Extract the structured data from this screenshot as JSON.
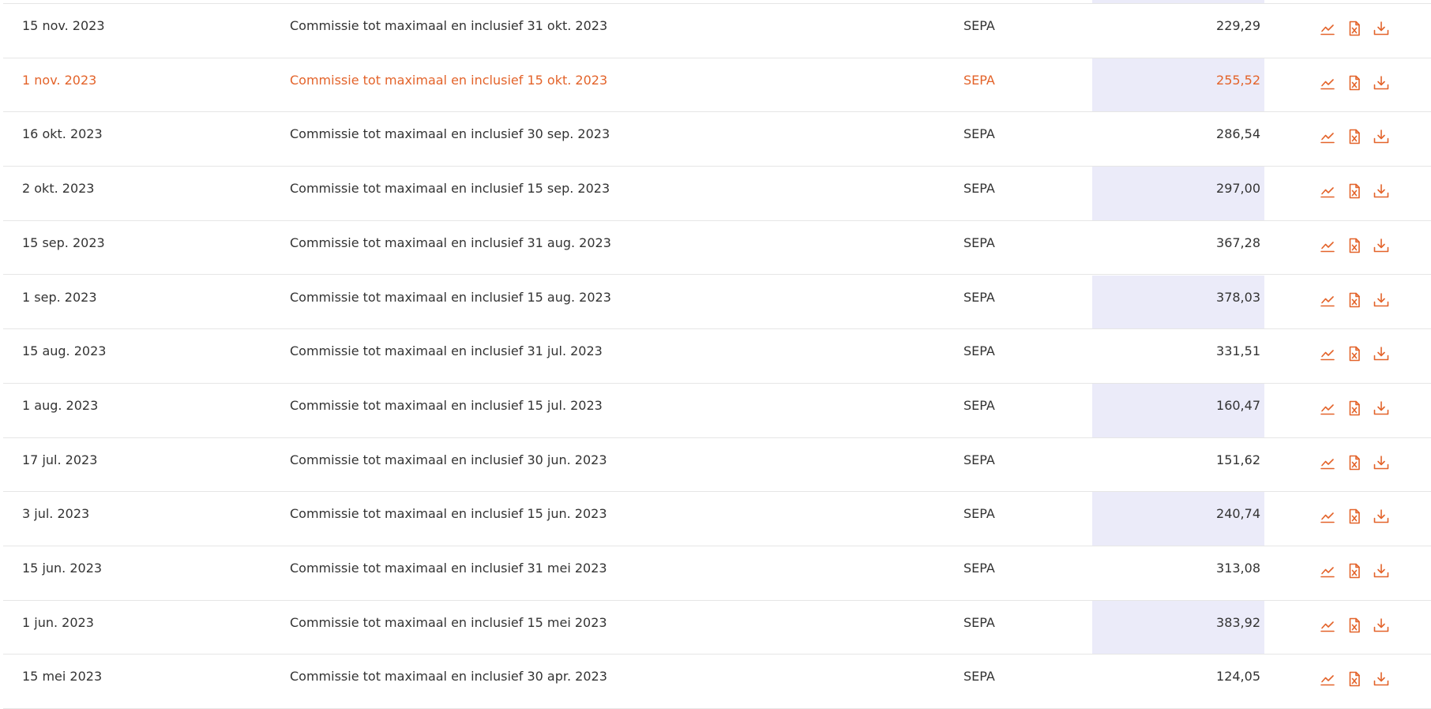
{
  "colors": {
    "accent": "#e3632a",
    "highlight": "#ebebf9",
    "text": "#333333",
    "divider": "#e6e6e6"
  },
  "icons": [
    "chart-icon",
    "excel-file-icon",
    "download-icon"
  ],
  "rows": [
    {
      "date": "15 nov. 2023",
      "description": "Commissie tot maximaal en inclusief 31 okt. 2023",
      "method": "SEPA",
      "amount": "229,29",
      "active": false,
      "highlighted": false
    },
    {
      "date": "1 nov. 2023",
      "description": "Commissie tot maximaal en inclusief 15 okt. 2023",
      "method": "SEPA",
      "amount": "255,52",
      "active": true,
      "highlighted": true
    },
    {
      "date": "16 okt. 2023",
      "description": "Commissie tot maximaal en inclusief 30 sep. 2023",
      "method": "SEPA",
      "amount": "286,54",
      "active": false,
      "highlighted": false
    },
    {
      "date": "2 okt. 2023",
      "description": "Commissie tot maximaal en inclusief 15 sep. 2023",
      "method": "SEPA",
      "amount": "297,00",
      "active": false,
      "highlighted": true
    },
    {
      "date": "15 sep. 2023",
      "description": "Commissie tot maximaal en inclusief 31 aug. 2023",
      "method": "SEPA",
      "amount": "367,28",
      "active": false,
      "highlighted": false
    },
    {
      "date": "1 sep. 2023",
      "description": "Commissie tot maximaal en inclusief 15 aug. 2023",
      "method": "SEPA",
      "amount": "378,03",
      "active": false,
      "highlighted": true
    },
    {
      "date": "15 aug. 2023",
      "description": "Commissie tot maximaal en inclusief 31 jul. 2023",
      "method": "SEPA",
      "amount": "331,51",
      "active": false,
      "highlighted": false
    },
    {
      "date": "1 aug. 2023",
      "description": "Commissie tot maximaal en inclusief 15 jul. 2023",
      "method": "SEPA",
      "amount": "160,47",
      "active": false,
      "highlighted": true
    },
    {
      "date": "17 jul. 2023",
      "description": "Commissie tot maximaal en inclusief 30 jun. 2023",
      "method": "SEPA",
      "amount": "151,62",
      "active": false,
      "highlighted": false
    },
    {
      "date": "3 jul. 2023",
      "description": "Commissie tot maximaal en inclusief 15 jun. 2023",
      "method": "SEPA",
      "amount": "240,74",
      "active": false,
      "highlighted": true
    },
    {
      "date": "15 jun. 2023",
      "description": "Commissie tot maximaal en inclusief 31 mei 2023",
      "method": "SEPA",
      "amount": "313,08",
      "active": false,
      "highlighted": false
    },
    {
      "date": "1 jun. 2023",
      "description": "Commissie tot maximaal en inclusief 15 mei 2023",
      "method": "SEPA",
      "amount": "383,92",
      "active": false,
      "highlighted": true
    },
    {
      "date": "15 mei 2023",
      "description": "Commissie tot maximaal en inclusief 30 apr. 2023",
      "method": "SEPA",
      "amount": "124,05",
      "active": false,
      "highlighted": false
    }
  ]
}
